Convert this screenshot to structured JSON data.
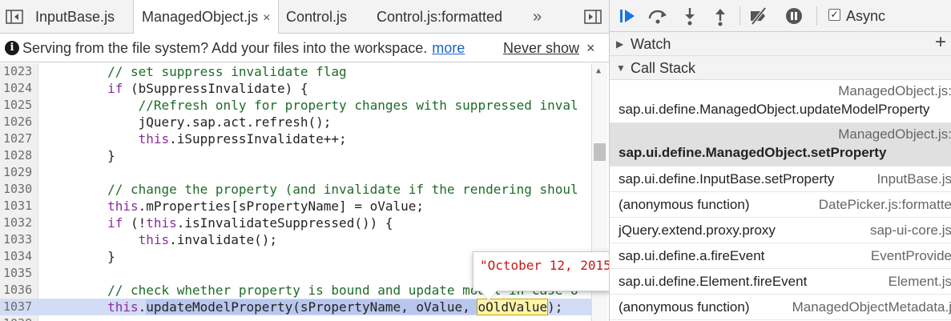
{
  "colors": {
    "accent": "#1a73e8",
    "keyword": "#8a2e9d",
    "comment": "#1f6b2a",
    "string": "#c41a16",
    "selected_frame": "#e0e0e0"
  },
  "tabs": [
    {
      "label": "InputBase.js",
      "active": false
    },
    {
      "label": "ManagedObject.js",
      "active": true,
      "close": "×"
    },
    {
      "label": "Control.js",
      "active": false
    },
    {
      "label": "Control.js:formatted",
      "active": false
    }
  ],
  "tab_overflow": "»",
  "infobar": {
    "message": "Serving from the file system? Add your files into the workspace.",
    "more_link": "more",
    "never_show": "Never show",
    "close": "×"
  },
  "code": {
    "lines": [
      {
        "n": "1023",
        "indent": "        ",
        "parts": [
          {
            "t": "// set suppress invalidate flag",
            "c": "cm"
          }
        ]
      },
      {
        "n": "1024",
        "indent": "        ",
        "parts": [
          {
            "t": "if",
            "c": "kw"
          },
          {
            "t": " (bSuppressInvalidate) {",
            "c": ""
          }
        ]
      },
      {
        "n": "1025",
        "indent": "            ",
        "parts": [
          {
            "t": "//Refresh only for property changes with suppressed inval",
            "c": "cm"
          }
        ]
      },
      {
        "n": "1026",
        "indent": "            ",
        "parts": [
          {
            "t": "jQuery.sap.act.refresh();",
            "c": ""
          }
        ]
      },
      {
        "n": "1027",
        "indent": "            ",
        "parts": [
          {
            "t": "this",
            "c": "kw"
          },
          {
            "t": ".iSuppressInvalidate++;",
            "c": ""
          }
        ]
      },
      {
        "n": "1028",
        "indent": "        ",
        "parts": [
          {
            "t": "}",
            "c": ""
          }
        ]
      },
      {
        "n": "1029",
        "indent": "",
        "parts": []
      },
      {
        "n": "1030",
        "indent": "        ",
        "parts": [
          {
            "t": "// change the property (and invalidate if the rendering shoul",
            "c": "cm"
          }
        ]
      },
      {
        "n": "1031",
        "indent": "        ",
        "parts": [
          {
            "t": "this",
            "c": "kw"
          },
          {
            "t": ".mProperties[sPropertyName] = oValue;",
            "c": ""
          }
        ]
      },
      {
        "n": "1032",
        "indent": "        ",
        "parts": [
          {
            "t": "if",
            "c": "kw"
          },
          {
            "t": " (!",
            "c": ""
          },
          {
            "t": "this",
            "c": "kw"
          },
          {
            "t": ".isInvalidateSuppressed()) {",
            "c": ""
          }
        ]
      },
      {
        "n": "1033",
        "indent": "            ",
        "parts": [
          {
            "t": "this",
            "c": "kw"
          },
          {
            "t": ".invalidate();",
            "c": ""
          }
        ]
      },
      {
        "n": "1034",
        "indent": "        ",
        "parts": [
          {
            "t": "}",
            "c": ""
          }
        ]
      },
      {
        "n": "1035",
        "indent": "",
        "parts": []
      },
      {
        "n": "1036",
        "indent": "        ",
        "parts": [
          {
            "t": "// check whether property is bound and update model in case o",
            "c": "cm"
          }
        ]
      },
      {
        "n": "1037",
        "indent": "        ",
        "current": true,
        "parts": [
          {
            "t": "this",
            "c": "kw"
          },
          {
            "t": ".",
            "c": ""
          },
          {
            "t": "updateModelProperty(sPropertyName, oValue, ",
            "c": "hl"
          },
          {
            "t": "oOldValue",
            "c": "hl2"
          },
          {
            "t": ");",
            "c": ""
          }
        ]
      },
      {
        "n": "1038",
        "indent": "",
        "parts": []
      }
    ]
  },
  "tooltip": {
    "value": "\"October 12, 2015\""
  },
  "debugger": {
    "async_label": "Async",
    "async_checked": "✓",
    "watch_label": "Watch",
    "watch_add": "+",
    "callstack_label": "Call Stack",
    "frames": [
      {
        "fn": "sap.ui.define.ManagedObject.updateModelProperty",
        "loc": "ManagedObject.js:",
        "two_line": true,
        "selected": false
      },
      {
        "fn": "sap.ui.define.ManagedObject.setProperty",
        "loc": "ManagedObject.js:",
        "two_line": true,
        "selected": true
      },
      {
        "fn": "sap.ui.define.InputBase.setProperty",
        "loc": "InputBase.js",
        "two_line": false,
        "selected": false
      },
      {
        "fn": "(anonymous function)",
        "loc": "DatePicker.js:formatte",
        "two_line": false,
        "selected": false
      },
      {
        "fn": "jQuery.extend.proxy.proxy",
        "loc": "sap-ui-core.js",
        "two_line": false,
        "selected": false
      },
      {
        "fn": "sap.ui.define.a.fireEvent",
        "loc": "EventProvide",
        "two_line": false,
        "selected": false
      },
      {
        "fn": "sap.ui.define.Element.fireEvent",
        "loc": "Element.js",
        "two_line": false,
        "selected": false
      },
      {
        "fn": "(anonymous function)",
        "loc": "ManagedObjectMetadata.j",
        "two_line": false,
        "selected": false
      }
    ]
  }
}
